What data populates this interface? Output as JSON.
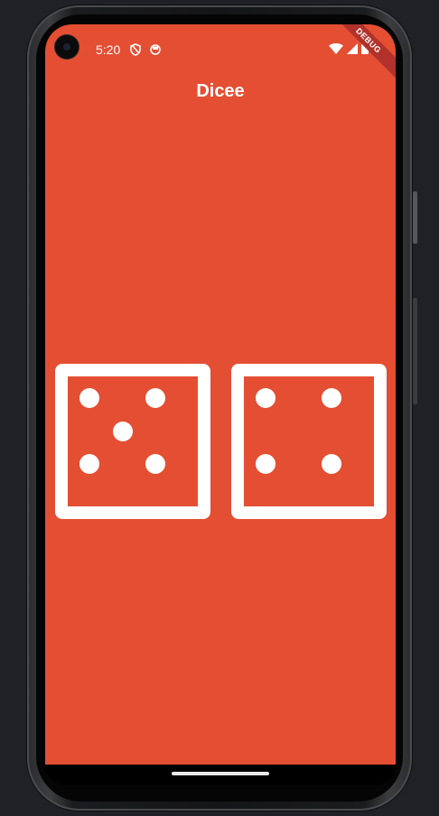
{
  "status_bar": {
    "time": "5:20",
    "icons": [
      "shield-icon",
      "sim-card-icon",
      "wifi-icon",
      "cell-signal-icon",
      "battery-icon"
    ]
  },
  "debug_banner": {
    "label": "DEBUG"
  },
  "app_bar": {
    "title": "Dicee"
  },
  "dice": {
    "left": {
      "value": 5
    },
    "right": {
      "value": 4
    }
  },
  "colors": {
    "background": "#e44e32",
    "die": "#ffffff",
    "debug_banner": "#b1322b"
  }
}
